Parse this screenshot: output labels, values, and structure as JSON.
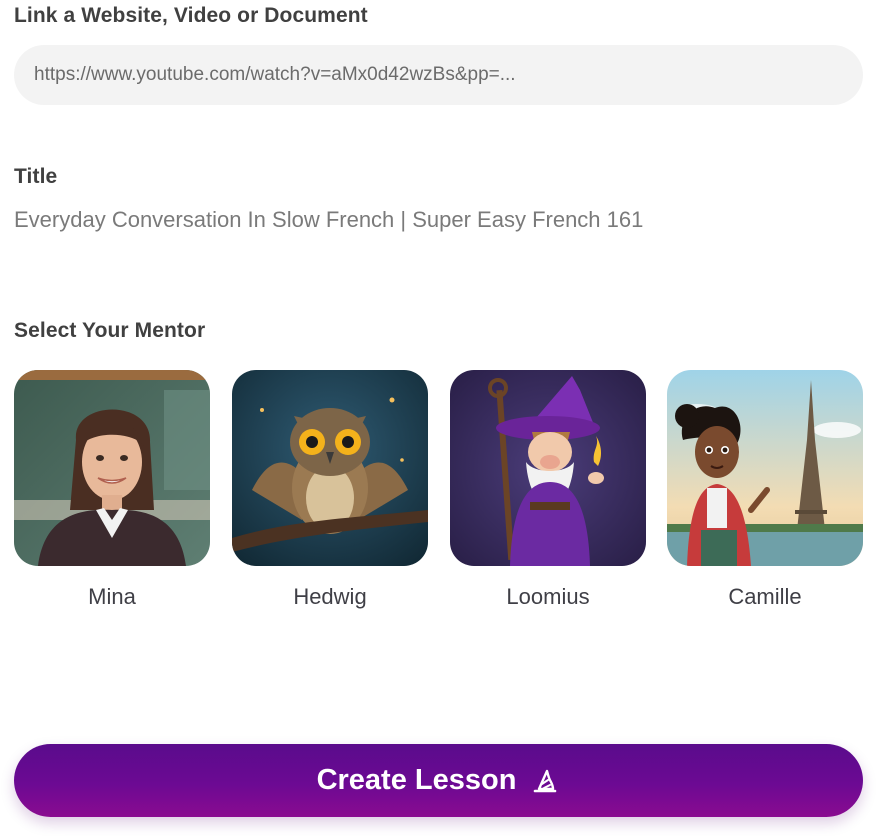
{
  "link_section": {
    "label": "Link a Website, Video or Document",
    "url_value": "https://www.youtube.com/watch?v=aMx0d42wzBs&pp=..."
  },
  "title_section": {
    "label": "Title",
    "value": "Everyday Conversation In Slow French | Super Easy French 161"
  },
  "mentor_section": {
    "label": "Select Your Mentor",
    "mentors": [
      {
        "name": "Mina"
      },
      {
        "name": "Hedwig"
      },
      {
        "name": "Loomius"
      },
      {
        "name": "Camille"
      }
    ]
  },
  "action": {
    "create_label": "Create Lesson",
    "icon": "wizard-hat-icon"
  },
  "colors": {
    "button_top": "#5a0b8c",
    "button_bottom": "#8a0b90",
    "input_bg": "#f3f3f3"
  }
}
